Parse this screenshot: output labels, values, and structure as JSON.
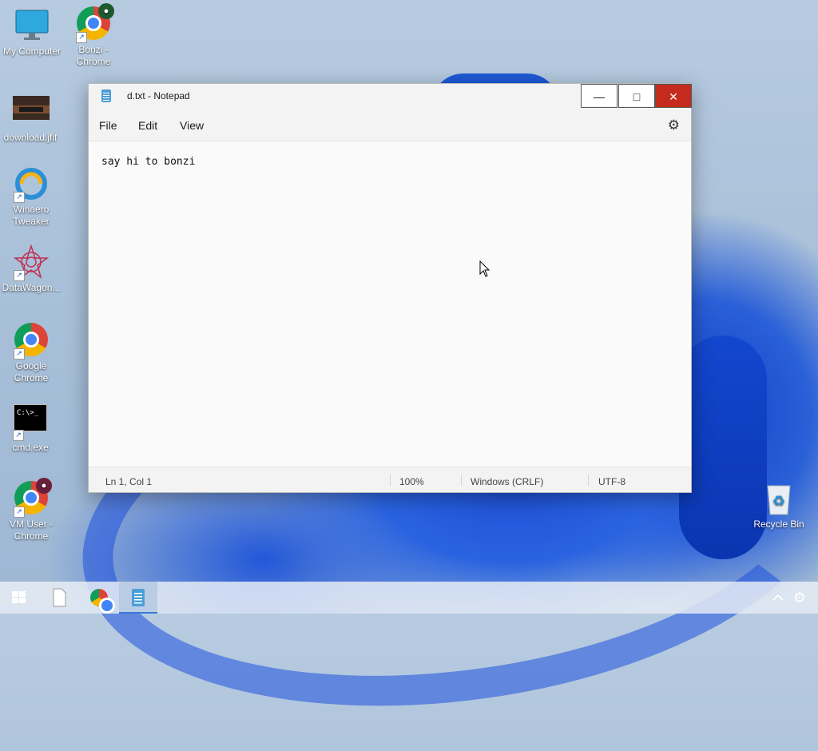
{
  "desktop": {
    "icons": [
      {
        "label_line1": "My Computer",
        "label_line2": ""
      },
      {
        "label_line1": "Bonzi -",
        "label_line2": "Chrome"
      },
      {
        "label_line1": "download.jfif",
        "label_line2": ""
      },
      {
        "label_line1": "Winaero",
        "label_line2": "Tweaker"
      },
      {
        "label_line1": "DataWagon...",
        "label_line2": ""
      },
      {
        "label_line1": "Google",
        "label_line2": "Chrome"
      },
      {
        "label_line1": "cmd.exe",
        "label_line2": ""
      },
      {
        "label_line1": "VM User -",
        "label_line2": "Chrome"
      },
      {
        "label_line1": "Recycle Bin",
        "label_line2": ""
      }
    ],
    "cmd_prompt": "C:\\>_"
  },
  "window": {
    "title": "d.txt - Notepad",
    "minimize_glyph": "—",
    "maximize_glyph": "□",
    "close_glyph": "✕",
    "menu": [
      "File",
      "Edit",
      "View"
    ],
    "settings_glyph": "⚙",
    "content": "say hi to bonzi",
    "status": {
      "position": "Ln 1, Col 1",
      "zoom": "100%",
      "line_ending": "Windows (CRLF)",
      "encoding": "UTF-8"
    }
  },
  "taskbar": {
    "items": [
      "start-icon",
      "file-explorer-icon",
      "chrome-icon",
      "notepad-icon"
    ],
    "tray": [
      "chevron-up-icon",
      "gear-icon"
    ]
  },
  "colors": {
    "accent": "#3a78d8",
    "close_button": "#c42b1c",
    "notepad_icon": "#4a9fd6"
  }
}
